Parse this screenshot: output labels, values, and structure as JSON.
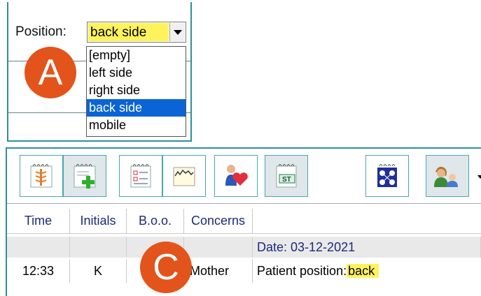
{
  "annotations": {
    "a": "A",
    "c": "C"
  },
  "position_field": {
    "label": "Position:",
    "selected": "back side",
    "options": [
      "[empty]",
      "left side",
      "right side",
      "back side",
      "mobile"
    ],
    "highlight_color": "#fff35c"
  },
  "toolbar": {
    "buttons": [
      {
        "icon": "caduceus-notepad-icon"
      },
      {
        "icon": "add-note-icon"
      },
      {
        "icon": "checklist-notepad-icon"
      },
      {
        "icon": "chart-note-icon"
      },
      {
        "icon": "heart-patient-icon"
      },
      {
        "icon": "st-notepad-icon",
        "text": "ST"
      },
      {
        "icon": "network-notepad-icon"
      },
      {
        "icon": "mother-child-icon"
      }
    ]
  },
  "table": {
    "columns": [
      "Time",
      "Initials",
      "B.o.o.",
      "Concerns"
    ],
    "date_row": "Date: 03-12-2021",
    "rows": [
      {
        "time": "12:33",
        "initials": "K",
        "boo": "",
        "concerns": "Mother",
        "note_prefix": "Patient position:",
        "note_value": "back"
      }
    ]
  }
}
